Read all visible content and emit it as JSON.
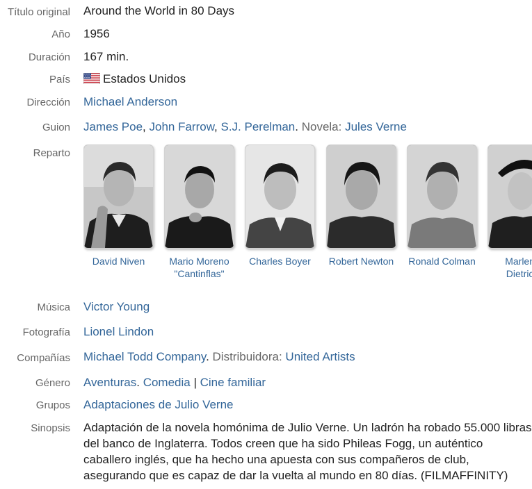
{
  "labels": {
    "original_title": "Título original",
    "year": "Año",
    "duration": "Duración",
    "country": "País",
    "direction": "Dirección",
    "script": "Guion",
    "cast": "Reparto",
    "music": "Música",
    "photography": "Fotografía",
    "companies": "Compañías",
    "genre": "Género",
    "groups": "Grupos",
    "synopsis": "Sinopsis"
  },
  "values": {
    "original_title": "Around the World in 80 Days",
    "year": "1956",
    "duration": "167 min.",
    "country": "Estados Unidos",
    "director": "Michael Anderson",
    "script": {
      "writers": [
        "James Poe",
        "John Farrow",
        "S.J. Perelman"
      ],
      "novel_label": "Novela:",
      "novel_author": "Jules Verne"
    },
    "music": "Victor Young",
    "photography": "Lionel Lindon",
    "companies": {
      "producer": "Michael Todd Company",
      "distributor_label": "Distribuidora:",
      "distributor": "United Artists"
    },
    "genre": [
      "Aventuras",
      "Comedia",
      "Cine familiar"
    ],
    "groups": "Adaptaciones de Julio Verne",
    "synopsis": "Adaptación de la novela homónima de Julio Verne. Un ladrón ha robado 55.000 libras del banco de Inglaterra. Todos creen que ha sido Phileas Fogg, un auténtico caballero inglés, que ha hecho una apuesta con sus compañeros de club, asegurando que es capaz de dar la vuelta al mundo en 80 días. (FILMAFFINITY)"
  },
  "cast": [
    {
      "line1": "David Niven",
      "line2": ""
    },
    {
      "line1": "Mario Moreno",
      "line2": "\"Cantinflas\""
    },
    {
      "line1": "Charles Boyer",
      "line2": ""
    },
    {
      "line1": "Robert Newton",
      "line2": ""
    },
    {
      "line1": "Ronald Colman",
      "line2": ""
    },
    {
      "line1": "Marlene",
      "line2": "Dietrich"
    }
  ],
  "icons": {
    "country_flag": "us-flag-icon"
  }
}
